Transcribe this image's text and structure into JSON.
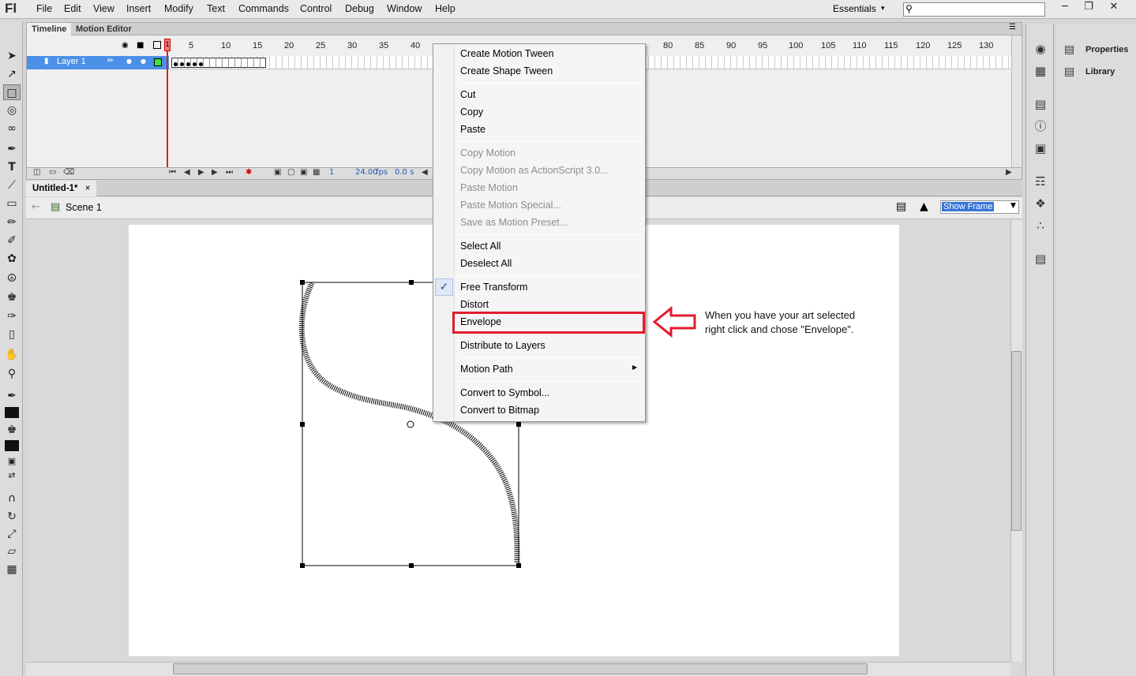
{
  "app": {
    "logo": "Fl",
    "menu": [
      "File",
      "Edit",
      "View",
      "Insert",
      "Modify",
      "Text",
      "Commands",
      "Control",
      "Debug",
      "Window",
      "Help"
    ],
    "workspace": "Essentials",
    "workspace_arrow": "▾",
    "search_icon": "search-icon",
    "window_controls": [
      "minimize-icon",
      "restore-icon",
      "close-icon"
    ]
  },
  "timeline": {
    "tabs": [
      "Timeline",
      "Motion Editor"
    ],
    "frame_numbers": [
      "1",
      "5",
      "10",
      "15",
      "20",
      "25",
      "30",
      "35",
      "40",
      "80",
      "85",
      "90",
      "95",
      "100",
      "105",
      "110",
      "115",
      "120",
      "125",
      "130"
    ],
    "layer_name": "Layer 1",
    "current_frame": "1",
    "fps": "24.00",
    "fps_unit": "fps",
    "elapsed": "0.0 s"
  },
  "document": {
    "tab": "Untitled-1*",
    "tab_close": "×",
    "scene": "Scene 1",
    "zoom": "Show Frame"
  },
  "right_panel": {
    "properties": "Properties",
    "library": "Library"
  },
  "context_menu": {
    "groups": [
      [
        {
          "label": "Create Motion Tween",
          "enabled": true
        },
        {
          "label": "Create Shape Tween",
          "enabled": true
        }
      ],
      [
        {
          "label": "Cut",
          "enabled": true
        },
        {
          "label": "Copy",
          "enabled": true
        },
        {
          "label": "Paste",
          "enabled": true
        }
      ],
      [
        {
          "label": "Copy Motion",
          "enabled": false
        },
        {
          "label": "Copy Motion as ActionScript 3.0...",
          "enabled": false
        },
        {
          "label": "Paste Motion",
          "enabled": false
        },
        {
          "label": "Paste Motion Special...",
          "enabled": false
        },
        {
          "label": "Save as Motion Preset...",
          "enabled": false
        }
      ],
      [
        {
          "label": "Select All",
          "enabled": true
        },
        {
          "label": "Deselect All",
          "enabled": true
        }
      ],
      [
        {
          "label": "Free Transform",
          "enabled": true,
          "checked": true
        },
        {
          "label": "Distort",
          "enabled": true
        },
        {
          "label": "Envelope",
          "enabled": true,
          "highlighted": true
        }
      ],
      [
        {
          "label": "Distribute to Layers",
          "enabled": true
        }
      ],
      [
        {
          "label": "Motion Path",
          "enabled": true,
          "submenu": true
        }
      ],
      [
        {
          "label": "Convert to Symbol...",
          "enabled": true
        },
        {
          "label": "Convert to Bitmap",
          "enabled": true
        }
      ]
    ],
    "check_glyph": "✓",
    "submenu_glyph": "▶"
  },
  "annotation": {
    "line1": "When you have your art selected",
    "line2": "right click and chose \"Envelope\".",
    "color": "#e21b2d"
  }
}
